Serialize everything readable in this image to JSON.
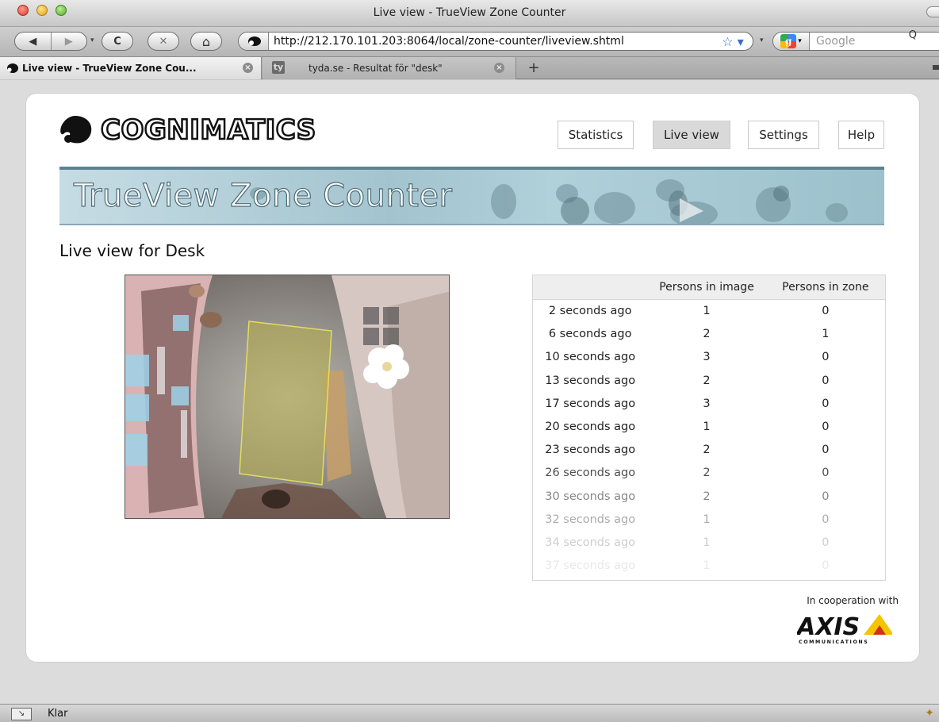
{
  "window": {
    "title": "Live view - TrueView Zone Counter"
  },
  "toolbar": {
    "back_glyph": "◀",
    "forward_glyph": "▶",
    "reload_glyph": "C",
    "stop_glyph": "✕",
    "home_glyph": "⌂",
    "url": "http://212.170.101.203:8064/local/zone-counter/liveview.shtml",
    "search_placeholder": "Google",
    "bookmark_glyph": "☆ ▾",
    "search_glyph": "Q"
  },
  "tabs": [
    {
      "label": "Live view - TrueView Zone Cou...",
      "active": true
    },
    {
      "label": "tyda.se - Resultat för \"desk\"",
      "active": false
    }
  ],
  "tab_add_glyph": "+",
  "tab_close_glyph": "×",
  "tab_fav_ty": "ty",
  "brand": {
    "logo_text": "COGNIMATICS",
    "banner_title": "TrueView Zone Counter"
  },
  "nav": {
    "statistics": "Statistics",
    "live_view": "Live view",
    "settings": "Settings",
    "help": "Help"
  },
  "page": {
    "heading": "Live view for Desk"
  },
  "table": {
    "headers": [
      "",
      "Persons in image",
      "Persons in zone"
    ],
    "rows": [
      {
        "time": "2 seconds ago",
        "image": "1",
        "zone": "0",
        "opacity": 1.0
      },
      {
        "time": "6 seconds ago",
        "image": "2",
        "zone": "1",
        "opacity": 1.0
      },
      {
        "time": "10 seconds ago",
        "image": "3",
        "zone": "0",
        "opacity": 1.0
      },
      {
        "time": "13 seconds ago",
        "image": "2",
        "zone": "0",
        "opacity": 1.0
      },
      {
        "time": "17 seconds ago",
        "image": "3",
        "zone": "0",
        "opacity": 1.0
      },
      {
        "time": "20 seconds ago",
        "image": "1",
        "zone": "0",
        "opacity": 1.0
      },
      {
        "time": "23 seconds ago",
        "image": "2",
        "zone": "0",
        "opacity": 1.0
      },
      {
        "time": "26 seconds ago",
        "image": "2",
        "zone": "0",
        "opacity": 0.8
      },
      {
        "time": "30 seconds ago",
        "image": "2",
        "zone": "0",
        "opacity": 0.55
      },
      {
        "time": "32 seconds ago",
        "image": "1",
        "zone": "0",
        "opacity": 0.38
      },
      {
        "time": "34 seconds ago",
        "image": "1",
        "zone": "0",
        "opacity": 0.22
      },
      {
        "time": "37 seconds ago",
        "image": "1",
        "zone": "0",
        "opacity": 0.1
      }
    ]
  },
  "footer": {
    "cooperation": "In cooperation with",
    "partner": "AXIS",
    "partner_sub": "COMMUNICATIONS"
  },
  "statusbar": {
    "text": "Klar"
  },
  "colors": {
    "zone_overlay": "#b8b04a",
    "banner": "#a3c4cf",
    "nav_active": "#d9d9d9"
  }
}
